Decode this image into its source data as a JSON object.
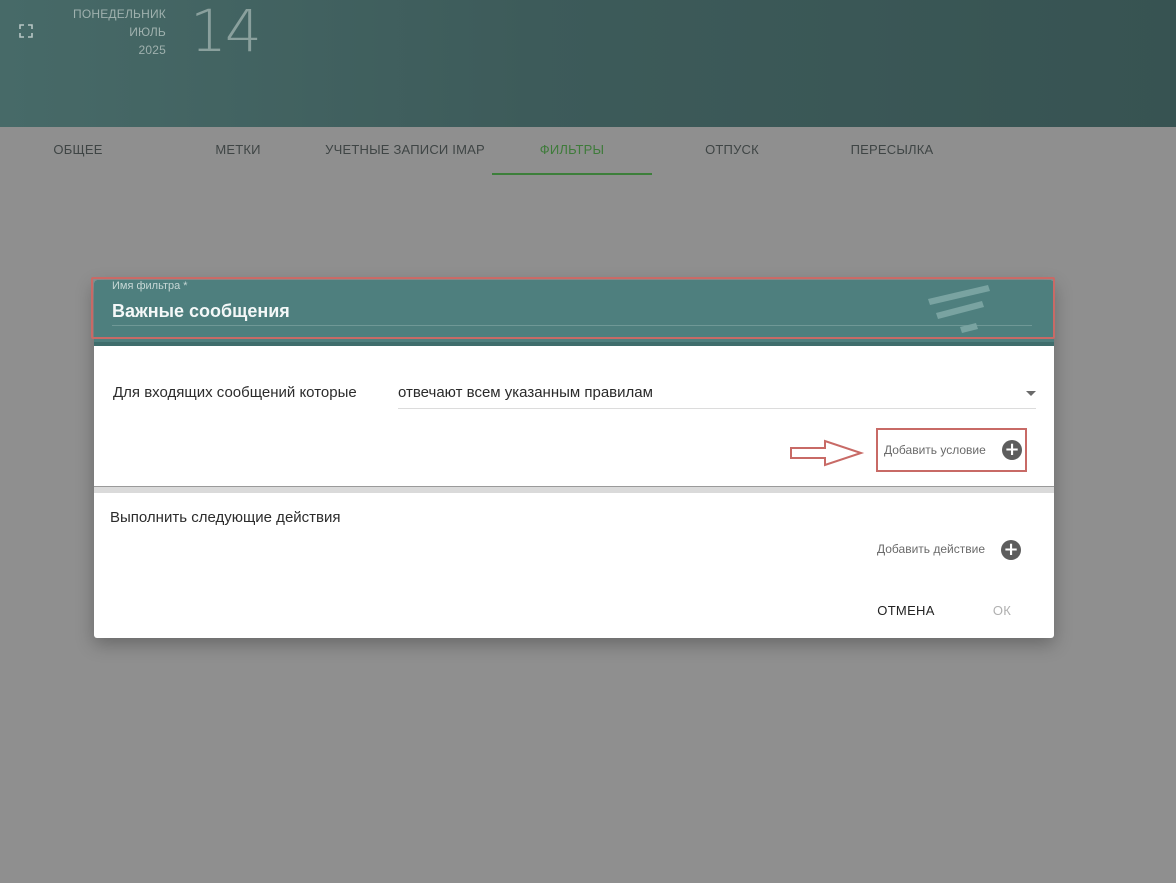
{
  "header": {
    "weekday": "ПОНЕДЕЛЬНИК",
    "month": "ИЮЛЬ",
    "year": "2025",
    "day": "14"
  },
  "tabs": [
    {
      "label": "ОБЩЕЕ"
    },
    {
      "label": "МЕТКИ"
    },
    {
      "label": "УЧЕТНЫЕ ЗАПИСИ IMAP"
    },
    {
      "label": "ФИЛЬТРЫ",
      "active": true
    },
    {
      "label": "ОТПУСК"
    },
    {
      "label": "ПЕРЕСЫЛКА"
    }
  ],
  "dialog": {
    "name_label": "Имя фильтра *",
    "name_value": "Важные сообщения",
    "condition_label": "Для входящих сообщений которые",
    "condition_select": "отвечают всем указанным правилам",
    "add_condition": "Добавить условие",
    "actions_title": "Выполнить следующие действия",
    "add_action": "Добавить действие",
    "cancel": "ОТМЕНА",
    "ok": "ОК"
  },
  "colors": {
    "header_bg": "#3f5e5d",
    "dialog_header_bg": "#4e7f7e",
    "active_tab": "#3e7b3a",
    "highlight": "#c86a66"
  },
  "icons": [
    "fullscreen-icon",
    "filter-logo-icon",
    "caret-down-icon",
    "arrow-right-icon",
    "plus-circle-icon"
  ]
}
